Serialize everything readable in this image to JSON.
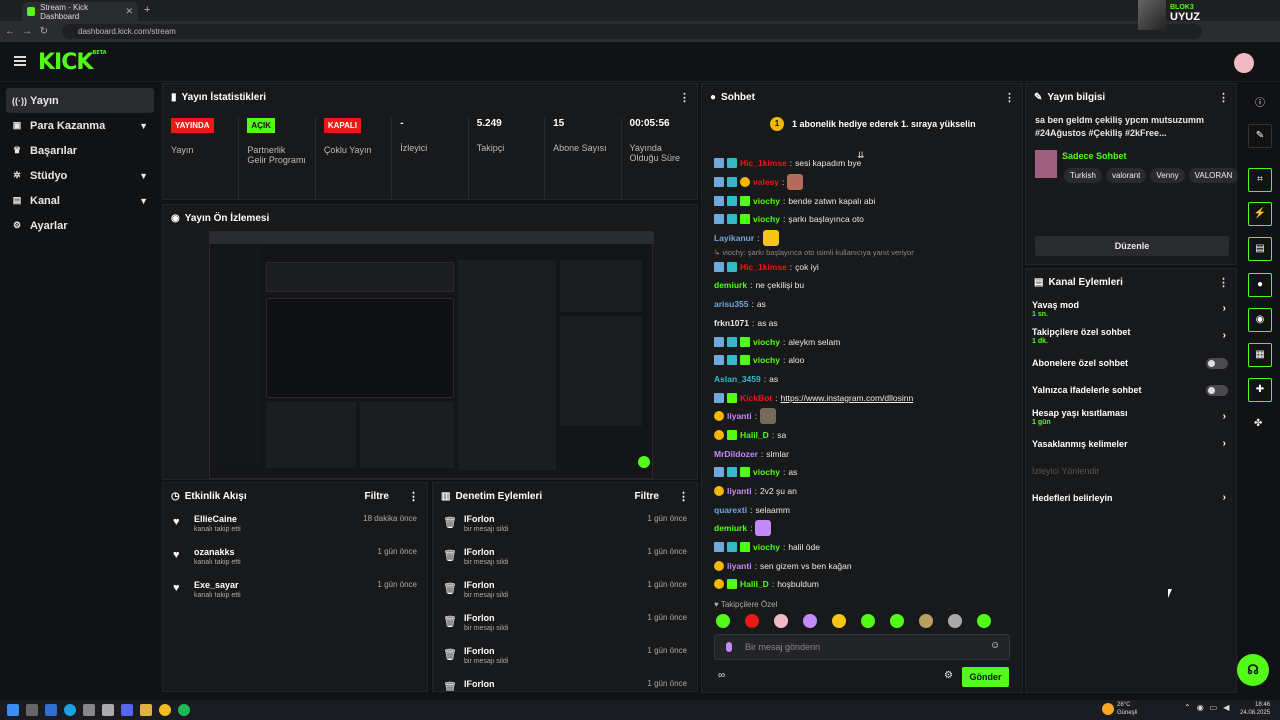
{
  "browser": {
    "tab_title": "Stream - Kick Dashboard",
    "url": "dashboard.kick.com/stream",
    "user_small": "BLOK3",
    "user_name": "UYUZ"
  },
  "app": {
    "logo": "KICK",
    "beta": "BETA"
  },
  "sidebar": {
    "items": [
      {
        "label": "Yayın",
        "icon": "broadcast-icon"
      },
      {
        "label": "Para Kazanma",
        "icon": "money-icon"
      },
      {
        "label": "Başarılar",
        "icon": "trophy-icon"
      },
      {
        "label": "Stüdyo",
        "icon": "gear-icon"
      },
      {
        "label": "Kanal",
        "icon": "channel-icon"
      },
      {
        "label": "Ayarlar",
        "icon": "settings-icon"
      }
    ]
  },
  "stats_panel": {
    "title": "Yayın İstatistikleri",
    "stats": [
      {
        "badge": "YAYINDA",
        "label": "Yayın"
      },
      {
        "badge": "AÇIK",
        "label": "Partnerlik Gelir Programı"
      },
      {
        "badge": "KAPALI",
        "label": "Çoklu Yayın"
      },
      {
        "value": "-",
        "label": "İzleyici"
      },
      {
        "value": "5.249",
        "label": "Takipçi"
      },
      {
        "value": "15",
        "label": "Abone Sayısı"
      },
      {
        "value": "00:05:56",
        "label": "Yayında Olduğu Süre"
      }
    ]
  },
  "preview_panel": {
    "title": "Yayın Ön İzlemesi"
  },
  "activity": {
    "title": "Etkinlik Akışı",
    "filter": "Filtre",
    "items": [
      {
        "name": "EllieCaine",
        "sub": "kanalı takip etti",
        "time": "18 dakika önce"
      },
      {
        "name": "ozanakks",
        "sub": "kanalı takip etti",
        "time": "1 gün önce"
      },
      {
        "name": "Exe_sayar",
        "sub": "kanalı takip etti",
        "time": "1 gün önce"
      }
    ]
  },
  "moderation": {
    "title": "Denetim Eylemleri",
    "filter": "Filtre",
    "items": [
      {
        "name": "IForlon",
        "sub": "bir mesajı sildi",
        "time": "1 gün önce"
      },
      {
        "name": "IForlon",
        "sub": "bir mesajı sildi",
        "time": "1 gün önce"
      },
      {
        "name": "IForlon",
        "sub": "bir mesajı sildi",
        "time": "1 gün önce"
      },
      {
        "name": "IForlon",
        "sub": "bir mesajı sildi",
        "time": "1 gün önce"
      },
      {
        "name": "IForlon",
        "sub": "bir mesajı sildi",
        "time": "1 gün önce"
      },
      {
        "name": "IForlon",
        "sub": "",
        "time": "1 gün önce"
      }
    ]
  },
  "chat": {
    "title": "Sohbet",
    "pinned_num": "1",
    "pinned_text": "1 abonelik hediye ederek 1. sıraya yükselin",
    "messages": [
      {
        "user": "Hic_1kimse",
        "color": "#e91916",
        "badges": [
          "b",
          "t"
        ],
        "text": "sesi kapadım bye"
      },
      {
        "user": "valesy",
        "color": "#e91916",
        "badges": [
          "b",
          "t",
          "y"
        ],
        "text": "",
        "emote": "#b36b5c"
      },
      {
        "user": "viochy",
        "color": "#53fc18",
        "badges": [
          "b",
          "t",
          "g"
        ],
        "text": "bende zatwn kapalı abi"
      },
      {
        "user": "viochy",
        "color": "#53fc18",
        "badges": [
          "b",
          "t",
          "g"
        ],
        "text": "şarkı başlayınca oto"
      },
      {
        "user": "Layikanur",
        "color": "#6fa8dc",
        "badges": [],
        "text": "",
        "emote": "#f5c518"
      },
      {
        "user": "",
        "color": "#888",
        "badges": [],
        "text": "↳ viochy: şarkı başlayınca oto isimli kullanıcıya yanıt veriyor",
        "reply": true
      },
      {
        "user": "Hic_1kimse",
        "color": "#e91916",
        "badges": [
          "b",
          "t"
        ],
        "text": "çok iyi"
      },
      {
        "user": "demiurk",
        "color": "#53fc18",
        "badges": [],
        "text": "ne çekilişi bu"
      },
      {
        "user": "arisu355",
        "color": "#6fa8dc",
        "badges": [],
        "text": "as"
      },
      {
        "user": "frkn1071",
        "color": "#e8e8e8",
        "badges": [],
        "text": "as as"
      },
      {
        "user": "viochy",
        "color": "#53fc18",
        "badges": [
          "b",
          "t",
          "g"
        ],
        "text": "aleykm selam"
      },
      {
        "user": "viochy",
        "color": "#53fc18",
        "badges": [
          "b",
          "t",
          "g"
        ],
        "text": "aloo"
      },
      {
        "user": "Aslan_3459",
        "color": "#36b8c9",
        "badges": [],
        "text": "as"
      },
      {
        "user": "KickBot",
        "color": "#e91916",
        "badges": [
          "b",
          "g"
        ],
        "text": "https://www.instagram.com/dllosinn",
        "link": true
      },
      {
        "user": "liyanti",
        "color": "#c58af9",
        "badges": [
          "y"
        ],
        "text": "",
        "emote": "#7a6a5a"
      },
      {
        "user": "Halil_D",
        "color": "#53fc18",
        "badges": [
          "y",
          "g"
        ],
        "text": "sa"
      },
      {
        "user": "MrDildozer",
        "color": "#c58af9",
        "badges": [],
        "text": "slmlar"
      },
      {
        "user": "viochy",
        "color": "#53fc18",
        "badges": [
          "b",
          "t",
          "g"
        ],
        "text": "as"
      },
      {
        "user": "liyanti",
        "color": "#c58af9",
        "badges": [
          "y"
        ],
        "text": "2v2 şu an"
      },
      {
        "user": "quarexti",
        "color": "#6fa8dc",
        "badges": [],
        "text": "selaamm"
      },
      {
        "user": "demiurk",
        "color": "#53fc18",
        "badges": [],
        "text": "",
        "emote": "#c58af9"
      },
      {
        "user": "viochy",
        "color": "#53fc18",
        "badges": [
          "b",
          "t",
          "g"
        ],
        "text": "halil öde"
      },
      {
        "user": "liyanti",
        "color": "#c58af9",
        "badges": [
          "y"
        ],
        "text": "sen gizem vs ben kağan"
      },
      {
        "user": "Halil_D",
        "color": "#53fc18",
        "badges": [
          "y",
          "g"
        ],
        "text": "hoşbuldum"
      }
    ],
    "follower_label": "Takipçilere Özel",
    "input_placeholder": "Bir mesaj gönderin",
    "send_label": "Gönder"
  },
  "stream_info": {
    "title": "Yayın bilgisi",
    "stream_title": "sa ben geldm çekiliş ypcm mutsuzumm #24Ağustos #Çekiliş #2kFree...",
    "category": "Sadece Sohbet",
    "tags": [
      "Turkish",
      "valorant",
      "Venny",
      "VALORAN"
    ],
    "edit": "Düzenle"
  },
  "channel_actions": {
    "title": "Kanal Eylemleri",
    "items": [
      {
        "label": "Yavaş mod",
        "sub": "1 sn.",
        "control": "chevron"
      },
      {
        "label": "Takipçilere özel sohbet",
        "sub": "1 dk.",
        "control": "chevron"
      },
      {
        "label": "Abonelere özel sohbet",
        "sub": "",
        "control": "toggle"
      },
      {
        "label": "Yalnızca ifadelerle sohbet",
        "sub": "",
        "control": "toggle"
      },
      {
        "label": "Hesap yaşı kısıtlaması",
        "sub": "1 gün",
        "control": "chevron"
      },
      {
        "label": "Yasaklanmış kelimeler",
        "sub": "",
        "control": "chevron"
      },
      {
        "label": "İzleyici Yönlendir",
        "sub": "",
        "control": "none",
        "dim": true
      },
      {
        "label": "Hedefleri belirleyin",
        "sub": "",
        "control": "chevron"
      }
    ]
  },
  "taskbar": {
    "weather_temp": "28°C",
    "weather_text": "Güneşli",
    "time": "18:46",
    "date": "24.08.2025"
  }
}
